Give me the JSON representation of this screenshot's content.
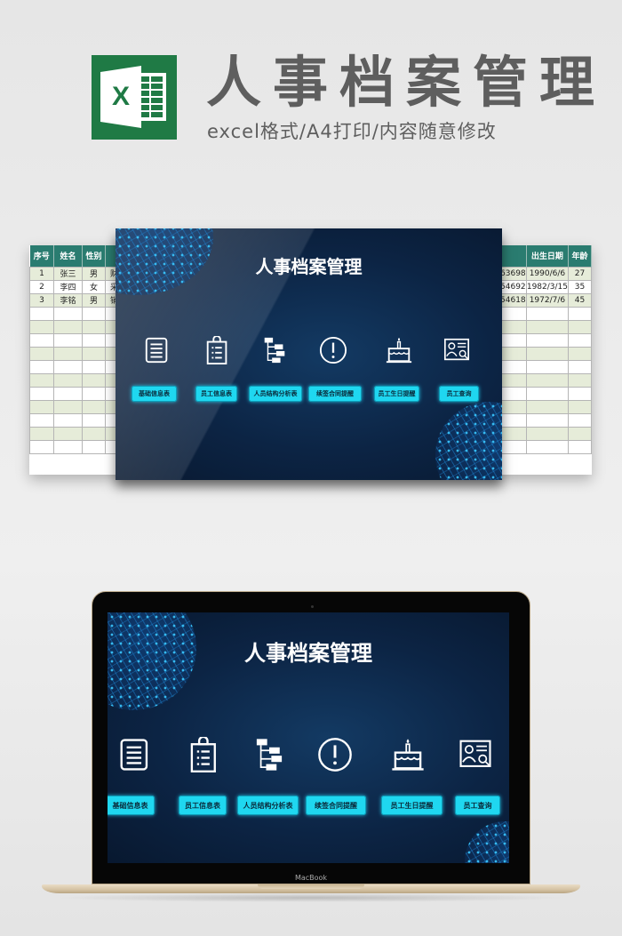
{
  "header": {
    "logo_letter": "X",
    "title": "人事档案管理",
    "subtitle": "excel格式/A4打印/内容随意修改"
  },
  "spreadsheet": {
    "left_columns": [
      "序号",
      "姓名",
      "性别",
      ""
    ],
    "left_rows": [
      [
        "1",
        "张三",
        "男",
        "财"
      ],
      [
        "2",
        "李四",
        "女",
        "采"
      ],
      [
        "3",
        "李铭",
        "男",
        "销"
      ]
    ],
    "right_columns": [
      "",
      "出生日期",
      "年龄"
    ],
    "right_rows": [
      [
        "63698",
        "1990/6/6",
        "27"
      ],
      [
        "54692",
        "1982/3/15",
        "35"
      ],
      [
        "54618",
        "1972/7/6",
        "45"
      ]
    ],
    "empty_rows": 11
  },
  "dashboard": {
    "title": "人事档案管理",
    "items": [
      {
        "icon": "list-icon",
        "label": "基础信息表"
      },
      {
        "icon": "clipboard-icon",
        "label": "员工信息表"
      },
      {
        "icon": "org-tree-icon",
        "label": "人员结构分析表"
      },
      {
        "icon": "alert-circle-icon",
        "label": "续签合同提醒"
      },
      {
        "icon": "birthday-cake-icon",
        "label": "员工生日提醒"
      },
      {
        "icon": "id-card-search-icon",
        "label": "员工查询"
      }
    ],
    "accent_color": "#1fd7f0",
    "background_color": "#0c2444"
  },
  "laptop": {
    "brand": "MacBook"
  }
}
